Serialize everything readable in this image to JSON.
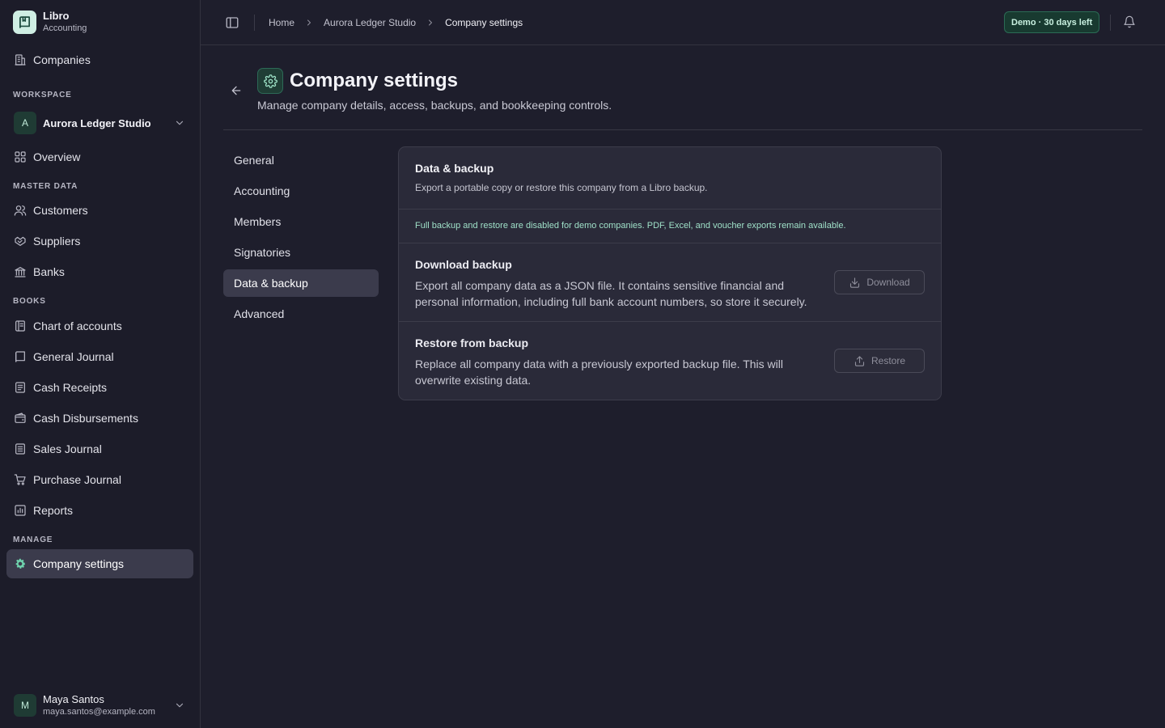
{
  "brand": {
    "name": "Libro",
    "subtitle": "Accounting",
    "icon": "book-icon"
  },
  "sidebar": {
    "top_item": {
      "label": "Companies",
      "icon": "building-icon"
    },
    "workspace_label": "WORKSPACE",
    "workspace": {
      "initial": "A",
      "name": "Aurora Ledger Studio"
    },
    "overview": {
      "label": "Overview",
      "icon": "grid-icon"
    },
    "master_data_label": "MASTER DATA",
    "master_data": [
      {
        "label": "Customers",
        "icon": "users-icon"
      },
      {
        "label": "Suppliers",
        "icon": "handshake-icon"
      },
      {
        "label": "Banks",
        "icon": "bank-icon"
      }
    ],
    "books_label": "BOOKS",
    "books": [
      {
        "label": "Chart of accounts",
        "icon": "book-open-icon"
      },
      {
        "label": "General Journal",
        "icon": "book-icon"
      },
      {
        "label": "Cash Receipts",
        "icon": "receipt-icon"
      },
      {
        "label": "Cash Disbursements",
        "icon": "wallet-icon"
      },
      {
        "label": "Sales Journal",
        "icon": "list-icon"
      },
      {
        "label": "Purchase Journal",
        "icon": "cart-icon"
      },
      {
        "label": "Reports",
        "icon": "bar-chart-icon"
      }
    ],
    "manage_label": "MANAGE",
    "manage": [
      {
        "label": "Company settings",
        "icon": "gear-icon",
        "active": true
      }
    ],
    "user": {
      "initial": "M",
      "name": "Maya Santos",
      "email": "maya.santos@example.com"
    }
  },
  "topbar": {
    "breadcrumb": [
      "Home",
      "Aurora Ledger Studio",
      "Company settings"
    ],
    "demo_badge": "Demo · 30 days left"
  },
  "page": {
    "title": "Company settings",
    "subtitle": "Manage company details, access, backups, and bookkeeping controls."
  },
  "settings_nav": [
    {
      "label": "General"
    },
    {
      "label": "Accounting"
    },
    {
      "label": "Members"
    },
    {
      "label": "Signatories"
    },
    {
      "label": "Data & backup",
      "active": true
    },
    {
      "label": "Advanced"
    }
  ],
  "card": {
    "title": "Data & backup",
    "description": "Export a portable copy or restore this company from a Libro backup.",
    "notice": "Full backup and restore are disabled for demo companies. PDF, Excel, and voucher exports remain available.",
    "download": {
      "title": "Download backup",
      "description": "Export all company data as a JSON file. It contains sensitive financial and personal information, including full bank account numbers, so store it securely.",
      "button": "Download",
      "disabled": true
    },
    "restore": {
      "title": "Restore from backup",
      "description": "Replace all company data with a previously exported backup file. This will overwrite existing data.",
      "button": "Restore",
      "disabled": true
    }
  },
  "colors": {
    "background": "#1e1e2c",
    "sidebar": "#1c1c29",
    "card": "#2a2a39",
    "accent": "#2b6b55",
    "accent_text": "#9fe0c8",
    "active_item": "#3b3b4c"
  }
}
